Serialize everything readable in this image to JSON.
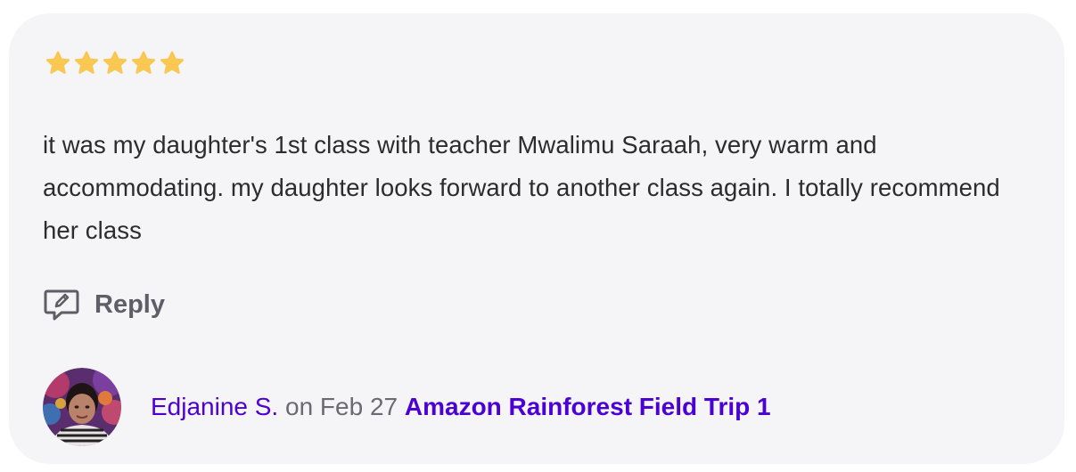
{
  "review": {
    "rating": 5,
    "rating_max": 5,
    "star_color": "#f8c853",
    "text": "it was my daughter's 1st class with teacher Mwalimu Saraah, very warm and accommodating. my daughter looks forward to another class again. I totally recommend her class"
  },
  "actions": {
    "reply_label": "Reply",
    "reply_icon": "chat-edit-icon"
  },
  "footer": {
    "author": "Edjanine S.",
    "date": " on Feb 27 ",
    "class_title": "Amazon Rainforest Field Trip 1"
  },
  "colors": {
    "card_background": "#f5f4f7",
    "link": "#4b01d4",
    "body_text": "#2c2c30",
    "muted_text": "#6b6a72"
  }
}
